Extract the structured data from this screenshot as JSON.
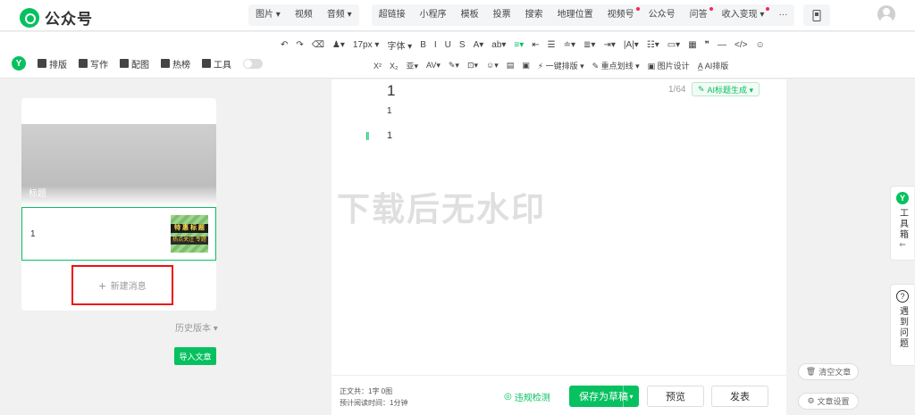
{
  "app": {
    "title": "公众号"
  },
  "topnav": {
    "group1": [
      {
        "label": "图片 ▾"
      },
      {
        "label": "视频"
      },
      {
        "label": "音频 ▾"
      }
    ],
    "group2": [
      {
        "label": "超链接"
      },
      {
        "label": "小程序"
      },
      {
        "label": "模板"
      },
      {
        "label": "投票"
      },
      {
        "label": "搜索"
      },
      {
        "label": "地理位置"
      },
      {
        "label": "视频号",
        "dot": true
      },
      {
        "label": "公众号"
      },
      {
        "label": "问答",
        "dot": true
      },
      {
        "label": "收入变现 ▾",
        "dot": true
      },
      {
        "label": "···"
      }
    ]
  },
  "left_tools": [
    {
      "label": "排版"
    },
    {
      "label": "写作"
    },
    {
      "label": "配图"
    },
    {
      "label": "热榜"
    },
    {
      "label": "工具"
    }
  ],
  "toolbar_row1": [
    "↶",
    "↷",
    "⌫",
    "♟▾",
    "17px ▾",
    "字体 ▾",
    "B",
    "I",
    "U",
    "S",
    "A▾",
    "ab▾",
    "≡▾",
    "⇤",
    "☰",
    "≐▾",
    "≣▾",
    "⇥▾",
    "|A|▾",
    "☷▾",
    "▭▾",
    "▦",
    "❞",
    "—",
    "</>",
    "☺"
  ],
  "toolbar_row2": [
    "X²",
    "X₂",
    "亚▾",
    "AV▾",
    "✎▾",
    "⊡▾",
    "☺▾",
    "▤",
    "▣",
    "⚡ 一键排版 ▾",
    "✎ 重点划线 ▾",
    "▣ 图片设计",
    "A̲ AI排版"
  ],
  "articles": {
    "cover_title": "标题",
    "item_title": "1",
    "thumb_line1": "特 惠 标 题",
    "thumb_line2": "热点关注 专题",
    "new_message": "新建消息"
  },
  "history": "历史版本 ▾",
  "import": "导入文章",
  "editor": {
    "title": "1",
    "word_count": "1/64",
    "ai_button": "AI标题生成 ▾",
    "line1": "1",
    "line2": "1",
    "watermark": "下载后无水印",
    "stats_line1": "正文共：1字 0图",
    "stats_line2": "预计阅读时间：1分钟",
    "compliance": "违规检测",
    "save": "保存为草稿",
    "preview": "预览",
    "publish": "发表"
  },
  "side": {
    "toolbox": "工具箱",
    "help": "遇到问题"
  },
  "right_buttons": {
    "clear": "清空文章",
    "settings": "文章设置"
  },
  "colors": {
    "accent": "#07c160",
    "highlight_box": "#e11111"
  }
}
